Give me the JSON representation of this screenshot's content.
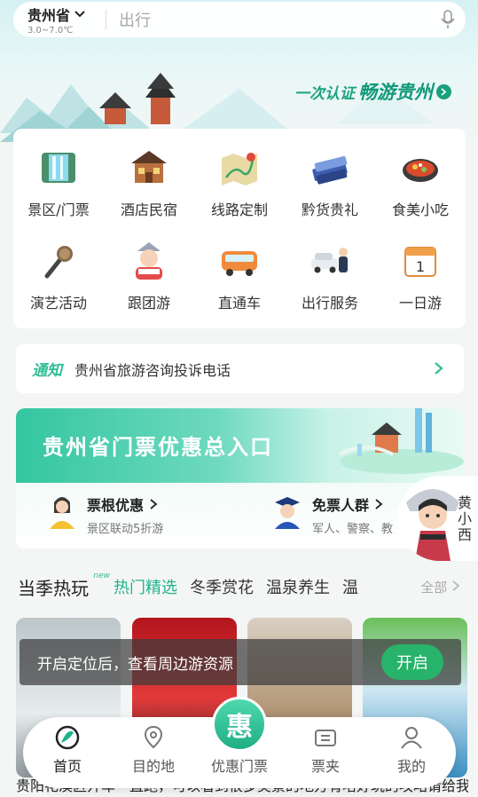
{
  "header": {
    "location": "贵州省",
    "temperature": "3.0~7.0℃",
    "search_placeholder": "出行",
    "slogan_part1": "一次认证",
    "slogan_part2": "畅游贵州"
  },
  "grid": [
    {
      "label": "景区/门票",
      "icon": "waterfall-icon"
    },
    {
      "label": "酒店民宿",
      "icon": "hotel-icon"
    },
    {
      "label": "线路定制",
      "icon": "map-route-icon"
    },
    {
      "label": "黔货贵礼",
      "icon": "gift-icon"
    },
    {
      "label": "食美小吃",
      "icon": "food-pan-icon"
    },
    {
      "label": "演艺活动",
      "icon": "microphone-icon"
    },
    {
      "label": "跟团游",
      "icon": "tour-guide-icon"
    },
    {
      "label": "直通车",
      "icon": "bus-icon"
    },
    {
      "label": "出行服务",
      "icon": "car-service-icon"
    },
    {
      "label": "一日游",
      "icon": "calendar-icon"
    }
  ],
  "notice": {
    "tag": "通知",
    "text": "贵州省旅游咨询投诉电话"
  },
  "promo": {
    "title": "贵州省门票优惠总入口",
    "items": [
      {
        "title": "票根优惠",
        "desc": "景区联动5折游"
      },
      {
        "title": "免票人群",
        "desc": "军人、警察、教"
      }
    ],
    "mascot_text": "黄小西"
  },
  "tabs": {
    "main": "当季热玩",
    "badge": "new",
    "items": [
      "热门精选",
      "冬季赏花",
      "温泉养生",
      "温"
    ],
    "all": "全部"
  },
  "toast": {
    "text": "开启定位后，查看周边游资源",
    "button": "开启"
  },
  "bottom_text": "贵阳花溪区开车一直跑，可以看到很多美景的地方有啥好玩的攻略请给我",
  "tabbar": {
    "items": [
      "首页",
      "目的地",
      "优惠门票",
      "票夹",
      "我的"
    ],
    "center_glyph": "惠"
  },
  "colors": {
    "accent": "#1fb38b",
    "toast_button": "#27b36a"
  }
}
